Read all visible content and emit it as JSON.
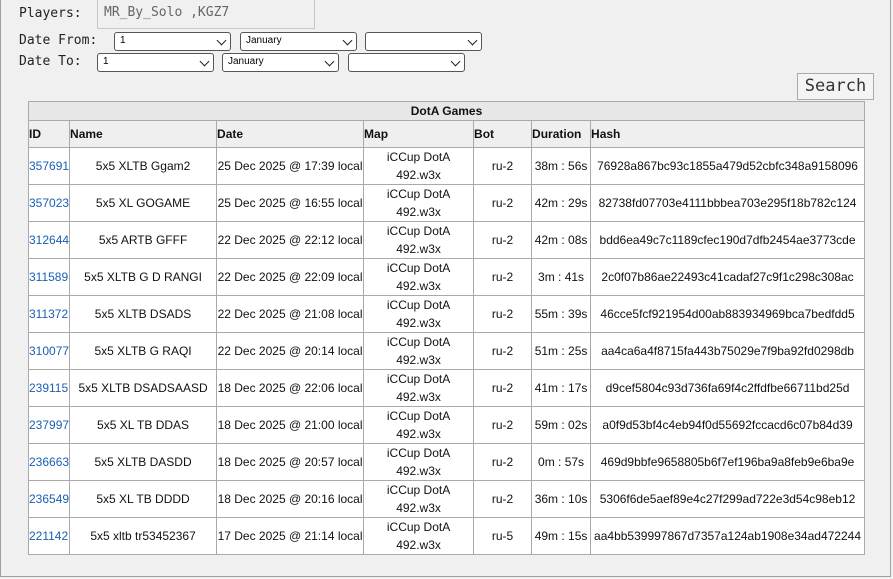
{
  "filters": {
    "players_label": "Players:",
    "players_value": "MR_By_Solo ,KGZ7",
    "date_from_label": "Date From:",
    "date_to_label": "Date To:",
    "from_day": "1",
    "from_month": "January",
    "from_year": "",
    "to_day": "1",
    "to_month": "January",
    "to_year": ""
  },
  "search_label": "Search",
  "table": {
    "caption": "DotA Games",
    "headers": [
      "ID",
      "Name",
      "Date",
      "Map",
      "Bot",
      "Duration",
      "Hash"
    ],
    "rows": [
      {
        "id": "357691",
        "name": "5x5 XLTB Ggam2",
        "date": "25 Dec 2025 @ 17:39 local",
        "map1": "iCCup DotA",
        "map2": "492.w3x",
        "bot": "ru-2",
        "duration": "38m : 56s",
        "hash": "76928a867bc93c1855a479d52cbfc348a9158096"
      },
      {
        "id": "357023",
        "name": "5x5 XL GOGAME",
        "date": "25 Dec 2025 @ 16:55 local",
        "map1": "iCCup DotA",
        "map2": "492.w3x",
        "bot": "ru-2",
        "duration": "42m : 29s",
        "hash": "82738fd07703e4111bbbea703e295f18b782c124"
      },
      {
        "id": "312644",
        "name": "5x5 ARTB GFFF",
        "date": "22 Dec 2025 @ 22:12 local",
        "map1": "iCCup DotA",
        "map2": "492.w3x",
        "bot": "ru-2",
        "duration": "42m : 08s",
        "hash": "bdd6ea49c7c1189cfec190d7dfb2454ae3773cde"
      },
      {
        "id": "311589",
        "name": "5x5 XLTB G D RANGI",
        "date": "22 Dec 2025 @ 22:09 local",
        "map1": "iCCup DotA",
        "map2": "492.w3x",
        "bot": "ru-2",
        "duration": "3m : 41s",
        "hash": "2c0f07b86ae22493c41cadaf27c9f1c298c308ac"
      },
      {
        "id": "311372",
        "name": "5x5 XLTB DSADS",
        "date": "22 Dec 2025 @ 21:08 local",
        "map1": "iCCup DotA",
        "map2": "492.w3x",
        "bot": "ru-2",
        "duration": "55m : 39s",
        "hash": "46cce5fcf921954d00ab883934969bca7bedfdd5"
      },
      {
        "id": "310077",
        "name": "5x5 XLTB G RAQI",
        "date": "22 Dec 2025 @ 20:14 local",
        "map1": "iCCup DotA",
        "map2": "492.w3x",
        "bot": "ru-2",
        "duration": "51m : 25s",
        "hash": "aa4ca6a4f8715fa443b75029e7f9ba92fd0298db"
      },
      {
        "id": "239115",
        "name": "5x5 XLTB DSADSAASD",
        "date": "18 Dec 2025 @ 22:06 local",
        "map1": "iCCup DotA",
        "map2": "492.w3x",
        "bot": "ru-2",
        "duration": "41m : 17s",
        "hash": "d9cef5804c93d736fa69f4c2ffdfbe66711bd25d"
      },
      {
        "id": "237997",
        "name": "5x5 XL TB DDAS",
        "date": "18 Dec 2025 @ 21:00 local",
        "map1": "iCCup DotA",
        "map2": "492.w3x",
        "bot": "ru-2",
        "duration": "59m : 02s",
        "hash": "a0f9d53bf4c4eb94f0d55692fccacd6c07b84d39"
      },
      {
        "id": "236663",
        "name": "5x5 XLTB DASDD",
        "date": "18 Dec 2025 @ 20:57 local",
        "map1": "iCCup DotA",
        "map2": "492.w3x",
        "bot": "ru-2",
        "duration": "0m : 57s",
        "hash": "469d9bbfe9658805b6f7ef196ba9a8feb9e6ba9e"
      },
      {
        "id": "236549",
        "name": "5x5 XL TB DDDD",
        "date": "18 Dec 2025 @ 20:16 local",
        "map1": "iCCup DotA",
        "map2": "492.w3x",
        "bot": "ru-2",
        "duration": "36m : 10s",
        "hash": "5306f6de5aef89e4c27f299ad722e3d54c98eb12"
      },
      {
        "id": "221142",
        "name": "5x5 xltb tr53452367",
        "date": "17 Dec 2025 @ 21:14 local",
        "map1": "iCCup DotA",
        "map2": "492.w3x",
        "bot": "ru-5",
        "duration": "49m : 15s",
        "hash": "aa4bb539997867d7357a124ab1908e34ad472244"
      }
    ]
  }
}
